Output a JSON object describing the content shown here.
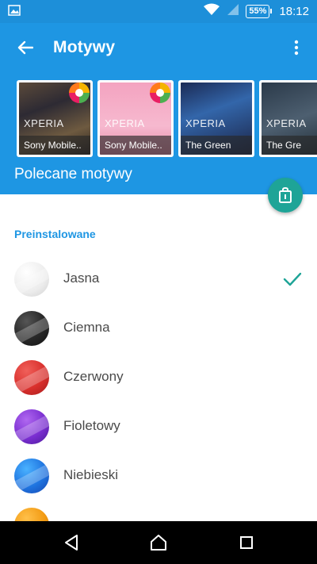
{
  "status_bar": {
    "battery": "55%",
    "time": "18:12"
  },
  "toolbar": {
    "title": "Motywy"
  },
  "featured": {
    "themes": [
      {
        "brand": "XPERIA",
        "caption": "Sony Mobile.."
      },
      {
        "brand": "XPERIA",
        "caption": "Sony Mobile.."
      },
      {
        "brand": "XPERIA",
        "caption": "The Green"
      },
      {
        "brand": "XPERIA",
        "caption": "The Gre"
      }
    ],
    "label": "Polecane motywy"
  },
  "preinstalled": {
    "header": "Preinstalowane",
    "themes": [
      {
        "name": "Jasna",
        "selected": true
      },
      {
        "name": "Ciemna",
        "selected": false
      },
      {
        "name": "Czerwony",
        "selected": false
      },
      {
        "name": "Fioletowy",
        "selected": false
      },
      {
        "name": "Niebieski",
        "selected": false
      }
    ]
  },
  "colors": {
    "primary": "#1e96e3",
    "status_bar": "#1d8fd9",
    "fab": "#1ea497",
    "check": "#1ea497"
  }
}
